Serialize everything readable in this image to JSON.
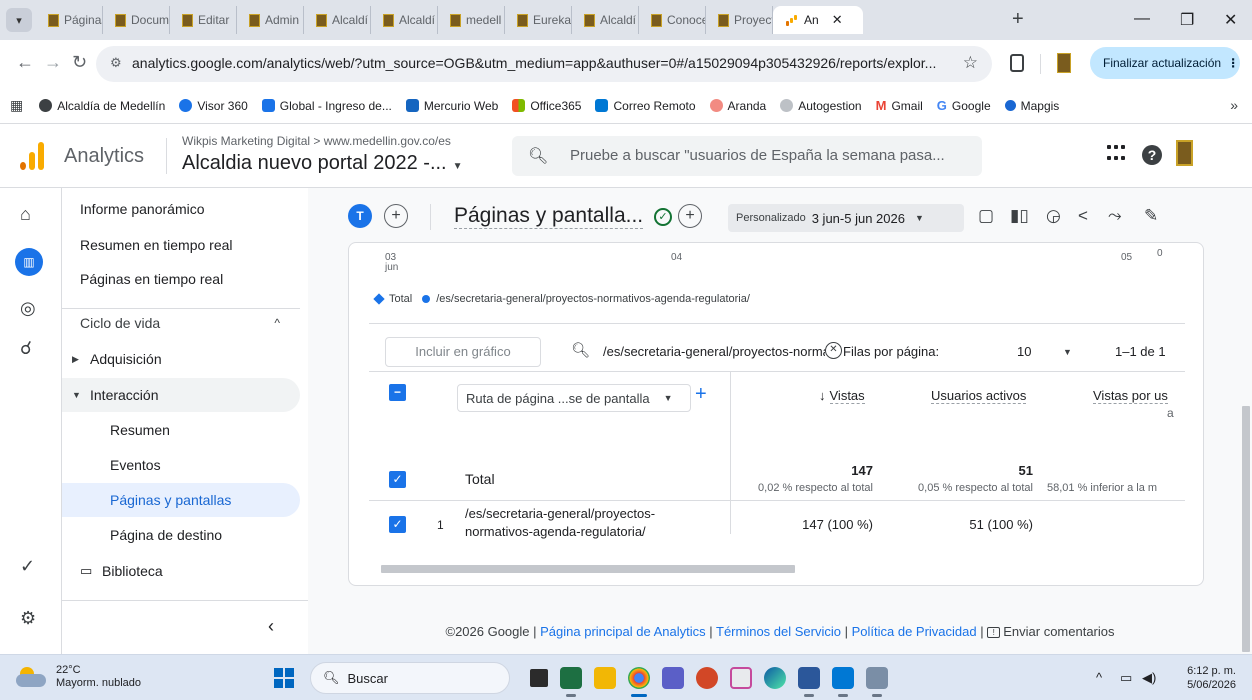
{
  "browser": {
    "tabs": [
      {
        "label": "Páginas"
      },
      {
        "label": "Docum"
      },
      {
        "label": "Editar"
      },
      {
        "label": "Admin"
      },
      {
        "label": "Alcaldí"
      },
      {
        "label": "Alcaldí"
      },
      {
        "label": "medell"
      },
      {
        "label": "Eureka"
      },
      {
        "label": "Alcaldí"
      },
      {
        "label": "Conoce"
      },
      {
        "label": "Proyect"
      }
    ],
    "active_tab": {
      "label": "An"
    },
    "url": "analytics.google.com/analytics/web/?utm_source=OGB&utm_medium=app&authuser=0#/a15029094p305432926/reports/explor...",
    "update_label": "Finalizar actualización",
    "bookmarks": [
      {
        "label": "Alcaldía de Medellín",
        "color": "#3c4043"
      },
      {
        "label": "Visor 360",
        "color": "#1a73e8"
      },
      {
        "label": "Global - Ingreso de...",
        "color": "#1a73e8"
      },
      {
        "label": "Mercurio Web",
        "color": "#1565c0"
      },
      {
        "label": "Office365",
        "color": "#f25022"
      },
      {
        "label": "Correo Remoto",
        "color": "#0078d4"
      },
      {
        "label": "Aranda",
        "color": "#f28b82"
      },
      {
        "label": "Autogestion",
        "color": "#9aa0a6"
      },
      {
        "label": "Gmail",
        "color": "#ea4335"
      },
      {
        "label": "Google",
        "color": "#4285f4"
      },
      {
        "label": "Mapgis",
        "color": "#1967d2"
      }
    ]
  },
  "ga": {
    "product": "Analytics",
    "account_path": "Wikpis Marketing Digital > www.medellin.gov.co/es",
    "property": "Alcaldia nuevo portal 2022 -...",
    "search_placeholder": "Pruebe a buscar \"usuarios de España la semana pasa...",
    "colors": {
      "brand": "#f9ab00",
      "accent": "#1a73e8"
    }
  },
  "nav": {
    "items": [
      {
        "label": "Informe panorámico"
      },
      {
        "label": "Resumen en tiempo real"
      },
      {
        "label": "Páginas en tiempo real"
      }
    ],
    "section": "Ciclo de vida",
    "acquisition": "Adquisición",
    "interaction": "Interacción",
    "sub_items": [
      {
        "label": "Resumen"
      },
      {
        "label": "Eventos"
      },
      {
        "label": "Páginas y pantallas"
      },
      {
        "label": "Página de destino"
      }
    ],
    "library": "Biblioteca"
  },
  "report": {
    "avatar_letter": "T",
    "title": "Páginas y pantalla...",
    "date_label": "Personalizado",
    "date_range": "3 jun-5 jun 2026"
  },
  "chart": {
    "x_labels": [
      "03\njun",
      "04",
      "05"
    ],
    "y_zero": "0",
    "legend_total": "Total",
    "legend_series": "/es/secretaria-general/proyectos-normativos-agenda-regulatoria/"
  },
  "table": {
    "include_button": "Incluir en gráfico",
    "filter_value": "/es/secretaria-general/proyectos-normativos-a",
    "rows_per_page_label": "Filas por página:",
    "rows_per_page": "10",
    "page_range": "1–1 de 1",
    "dimension": "Ruta de página ...se de pantalla",
    "col_views": "Vistas",
    "col_users": "Usuarios activos",
    "col_vpu": "Vistas por us",
    "col_vpu_2": "a",
    "total": {
      "label": "Total",
      "views": "147",
      "views_sub": "0,02 % respecto al total",
      "users": "51",
      "users_sub": "0,05 % respecto al total",
      "vpu_sub": "58,01 % inferior a la m"
    },
    "rows": [
      {
        "index": "1",
        "path": "/es/secretaria-general/proyectos-normativos-agenda-regulatoria/",
        "views": "147 (100 %)",
        "users": "51 (100 %)"
      }
    ]
  },
  "footer": {
    "copyright": "©2026 Google | ",
    "home": "Página principal de Analytics",
    "sep": " | ",
    "terms": "Términos del Servicio",
    "privacy": "Política de Privacidad",
    "feedback": "Enviar comentarios"
  },
  "taskbar": {
    "temp": "22°C",
    "weather": "Mayorm. nublado",
    "search": "Buscar",
    "time": "6:12 p. m.",
    "date": "5/06/2026"
  }
}
